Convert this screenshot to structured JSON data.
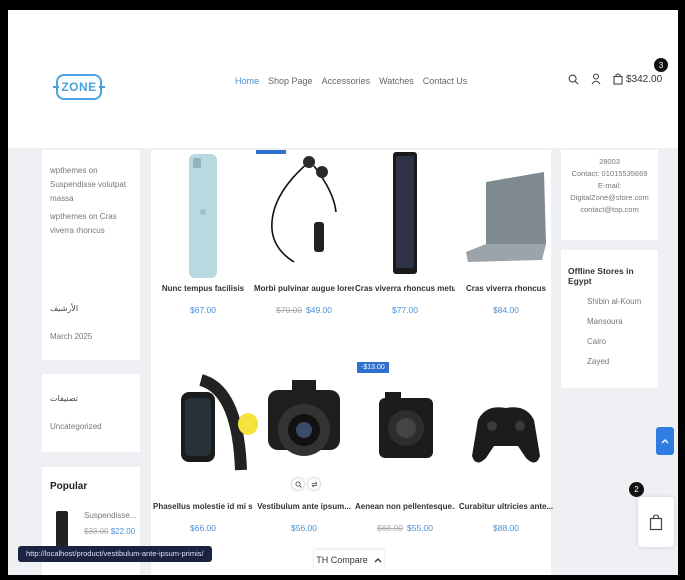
{
  "header": {
    "logo": "ZONE",
    "nav": [
      "Home",
      "Shop Page",
      "Accessories",
      "Watches",
      "Contact Us"
    ],
    "cart_total": "$342.00",
    "cart_count": "3"
  },
  "left_sidebar": {
    "recent_comments": [
      "wpthemes on Suspendisse volutpat massa",
      "wpthemes on Cras viverra rhoncus"
    ],
    "archives_title": "الأرشيف",
    "archive_month": "March 2025",
    "categories_title": "تصنيفات",
    "category": "Uncategorized",
    "popular_title": "Popular",
    "popular_item": {
      "name": "Suspendisse...",
      "old_price": "$33.00",
      "price": "$22.00"
    }
  },
  "products": [
    {
      "name": "Nunc tempus facilisis",
      "price": "$67.00",
      "old_price": ""
    },
    {
      "name": "Morbi pulvinar augue lorem",
      "price": "$49.00",
      "old_price": "$70.00"
    },
    {
      "name": "Cras viverra rhoncus metu",
      "price": "$77.00",
      "old_price": ""
    },
    {
      "name": "Cras viverra rhoncus",
      "price": "$84.00",
      "old_price": ""
    },
    {
      "name": "Phasellus molestie id mi si...",
      "price": "$66.00",
      "old_price": ""
    },
    {
      "name": "Vestibulum ante ipsum...",
      "price": "$56.00",
      "old_price": ""
    },
    {
      "name": "Aenean non pellentesque...",
      "price": "$55.00",
      "old_price": "$68.00"
    },
    {
      "name": "Curabitur ultricies ante...",
      "price": "$88.00",
      "old_price": ""
    }
  ],
  "sale_tag": "-$13.00",
  "right_sidebar": {
    "contact_lines": [
      "28003",
      "Contact: 01015535669",
      "E-mail:",
      "DigitalZone@store.com",
      "contact@top.com"
    ],
    "stores_title": "Offline Stores in Egypt",
    "stores": [
      "Shibin al-Koum",
      "Mansoura",
      "Cairo",
      "Zayed"
    ]
  },
  "floating_cart_count": "2",
  "status_url": "http://localhost/product/vestibulum-ante-ipsum-primis/",
  "compare_label": "TH Compare",
  "colors": {
    "accent": "#4a90d9",
    "sale": "#2f6fcf",
    "status_bar": "#1c2340"
  }
}
